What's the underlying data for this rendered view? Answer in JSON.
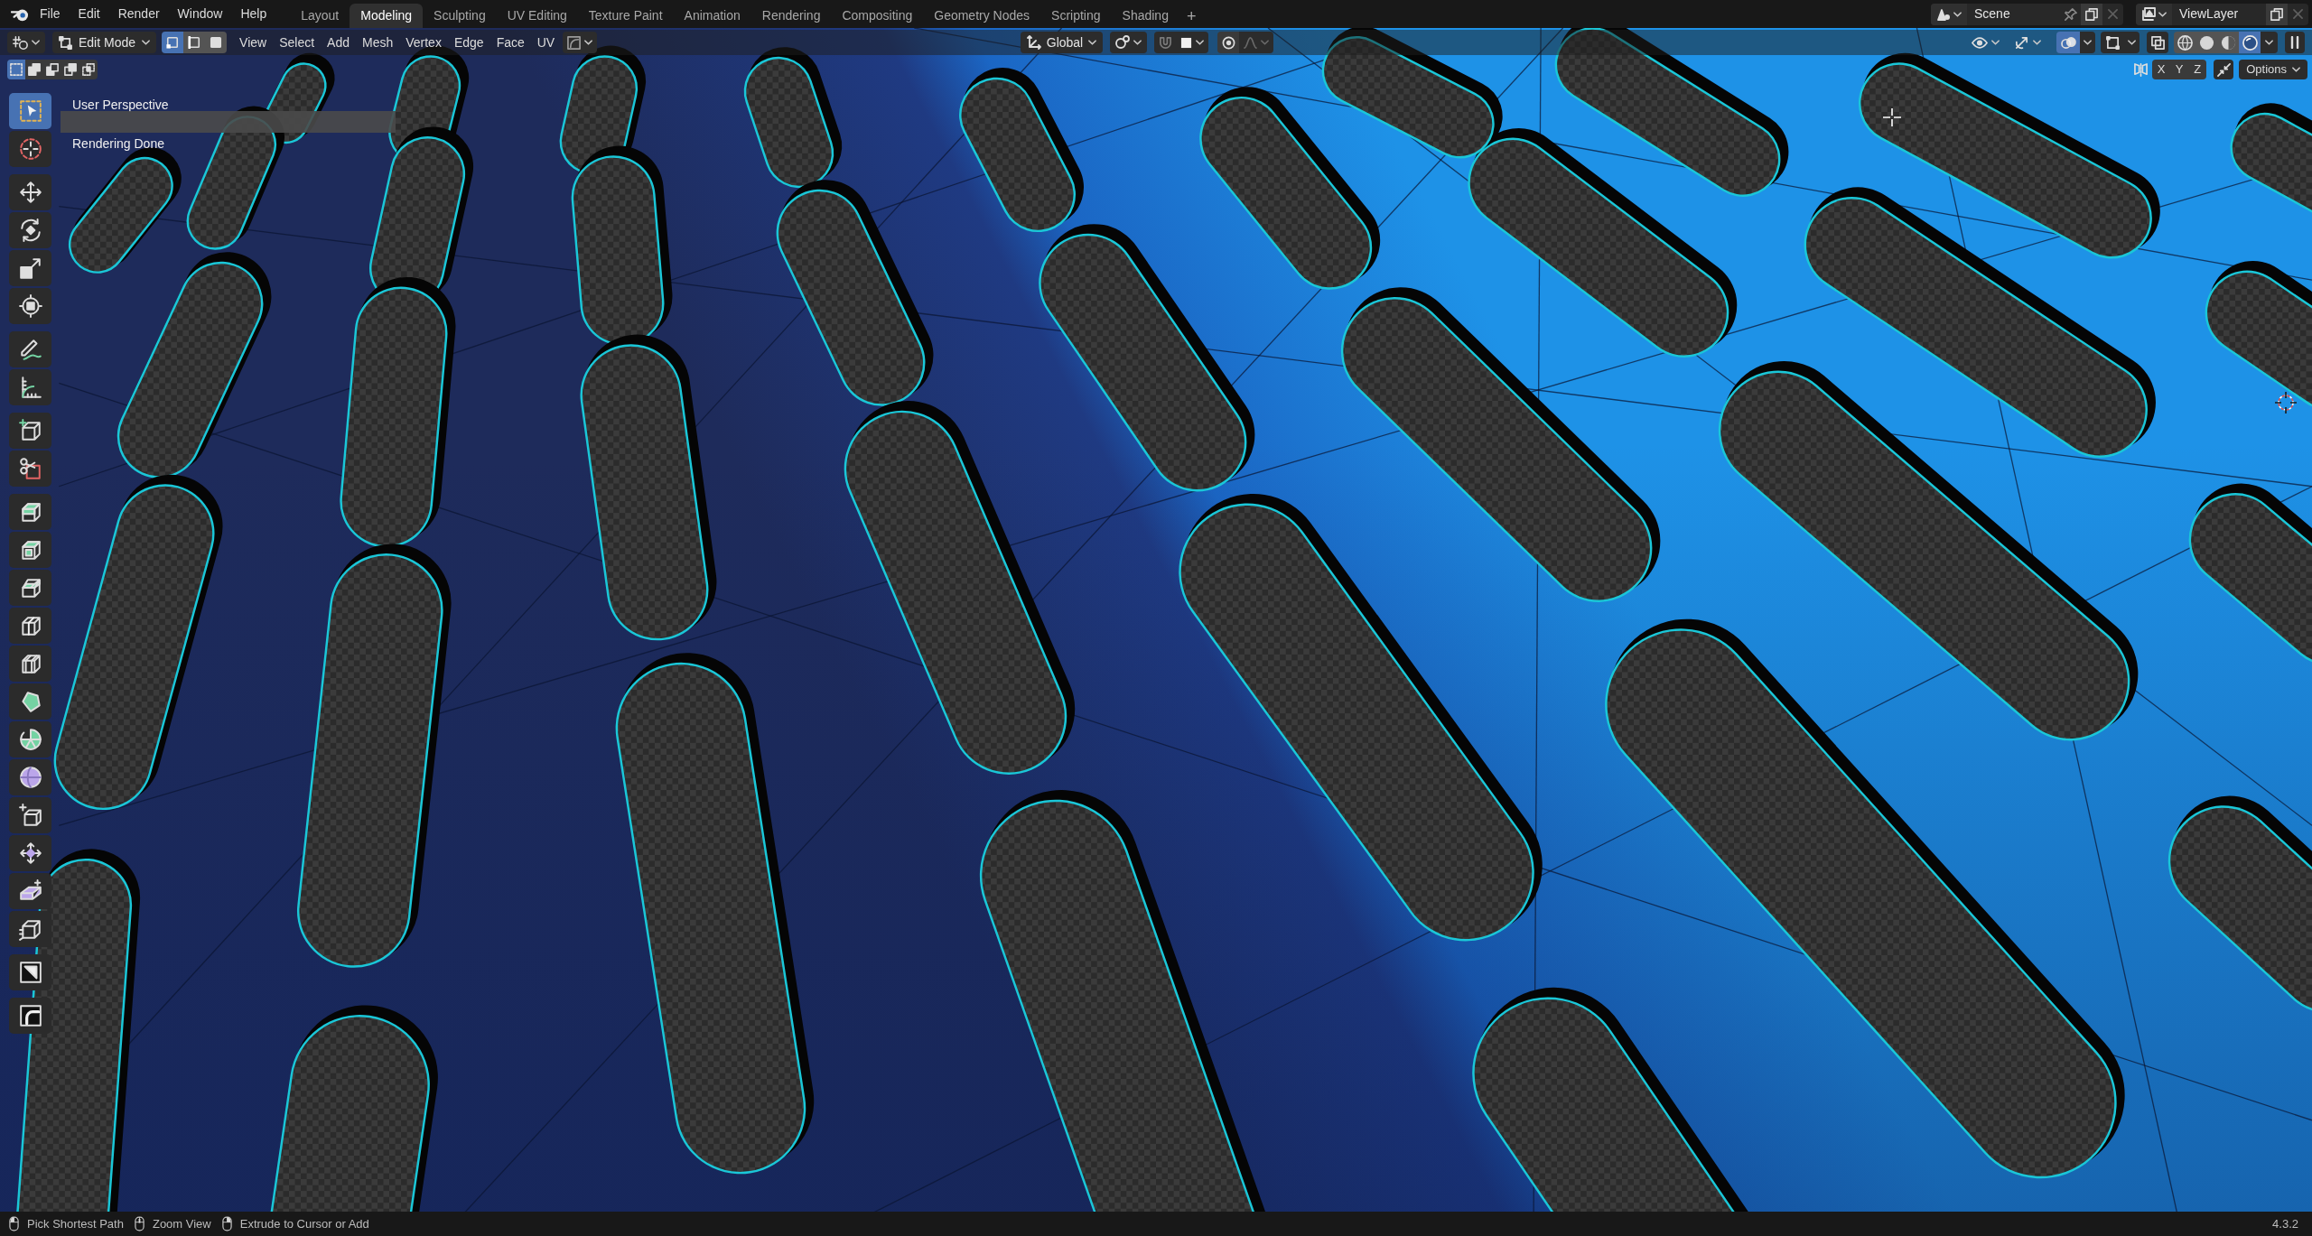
{
  "top_bar": {
    "menus": [
      "File",
      "Edit",
      "Render",
      "Window",
      "Help"
    ],
    "workspace_tabs": [
      {
        "label": "Layout",
        "selected": false
      },
      {
        "label": "Modeling",
        "selected": true
      },
      {
        "label": "Sculpting",
        "selected": false
      },
      {
        "label": "UV Editing",
        "selected": false
      },
      {
        "label": "Texture Paint",
        "selected": false
      },
      {
        "label": "Animation",
        "selected": false
      },
      {
        "label": "Rendering",
        "selected": false
      },
      {
        "label": "Compositing",
        "selected": false
      },
      {
        "label": "Geometry Nodes",
        "selected": false
      },
      {
        "label": "Scripting",
        "selected": false
      },
      {
        "label": "Shading",
        "selected": false
      }
    ],
    "add_workspace": "+",
    "scene": "Scene",
    "view_layer": "ViewLayer"
  },
  "header": {
    "mode": "Edit Mode",
    "select_modes": [
      {
        "kind": "vertex",
        "selected": true
      },
      {
        "kind": "edge",
        "selected": false
      },
      {
        "kind": "face",
        "selected": false
      }
    ],
    "menus": [
      "View",
      "Select",
      "Add",
      "Mesh",
      "Vertex",
      "Edge",
      "Face",
      "UV"
    ],
    "transform_orientation": "Global",
    "snap": {
      "on": false
    },
    "proportional_editing": {
      "on": false
    },
    "overlays": {
      "on": true
    },
    "xray": {
      "on": false
    },
    "shading_modes": [
      {
        "kind": "wireframe",
        "selected": false
      },
      {
        "kind": "solid",
        "selected": false
      },
      {
        "kind": "material",
        "selected": false
      },
      {
        "kind": "rendered",
        "selected": true
      }
    ]
  },
  "tool_header": {
    "select_box_modes": [
      {
        "kind": "set",
        "selected": true
      },
      {
        "kind": "extend",
        "selected": false
      },
      {
        "kind": "subtract",
        "selected": false
      },
      {
        "kind": "invert",
        "selected": false
      },
      {
        "kind": "intersect",
        "selected": false
      }
    ],
    "mirror_axes": [
      {
        "label": "X",
        "on": false
      },
      {
        "label": "Y",
        "on": false
      },
      {
        "label": "Z",
        "on": false
      }
    ],
    "options": "Options"
  },
  "viewport": {
    "view_name": "User Perspective",
    "render_status": "Rendering Done"
  },
  "toolbar": {
    "tool_groups": [
      {
        "tools": [
          {
            "kind": "select_box",
            "selected": true
          },
          {
            "kind": "cursor",
            "selected": false
          }
        ]
      },
      {
        "tools": [
          {
            "kind": "move",
            "selected": false
          },
          {
            "kind": "rotate",
            "selected": false
          },
          {
            "kind": "scale",
            "selected": false
          },
          {
            "kind": "transform",
            "selected": false
          }
        ]
      },
      {
        "tools": [
          {
            "kind": "annotate",
            "selected": false
          },
          {
            "kind": "measure",
            "selected": false
          }
        ]
      },
      {
        "tools": [
          {
            "kind": "add_cube",
            "selected": false
          },
          {
            "kind": "cutter",
            "selected": false
          }
        ]
      },
      {
        "tools": [
          {
            "kind": "extrude",
            "selected": false
          },
          {
            "kind": "inset",
            "selected": false
          },
          {
            "kind": "bevel",
            "selected": false
          },
          {
            "kind": "loop_cut",
            "selected": false
          },
          {
            "kind": "offset_loop",
            "selected": false
          },
          {
            "kind": "poly_build",
            "selected": false
          },
          {
            "kind": "spin",
            "selected": false
          },
          {
            "kind": "smooth",
            "selected": false
          },
          {
            "kind": "edge_slide",
            "selected": false
          },
          {
            "kind": "shrink_fatten",
            "selected": false
          },
          {
            "kind": "shear",
            "selected": false
          },
          {
            "kind": "rip",
            "selected": false
          }
        ]
      },
      {
        "tools": [
          {
            "kind": "region",
            "selected": false
          }
        ]
      },
      {
        "tools": [
          {
            "kind": "corner",
            "selected": false
          }
        ]
      }
    ]
  },
  "status_bar": {
    "hints": [
      {
        "kind": "left",
        "label": "Pick Shortest Path"
      },
      {
        "kind": "middle",
        "label": "Zoom View"
      },
      {
        "kind": "right",
        "label": "Extrude to Cursor or Add"
      }
    ],
    "version": "4.3.2"
  }
}
